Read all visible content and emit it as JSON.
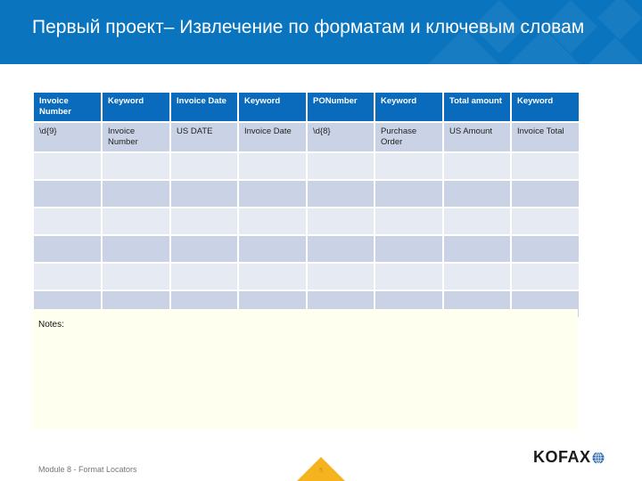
{
  "header": {
    "title": "Первый проект– Извлечение по форматам и ключевым словам",
    "background_color": "#0a74bf"
  },
  "table": {
    "columns": [
      "Invoice Number",
      "Keyword",
      "Invoice Date",
      "Keyword",
      "PONumber",
      "Keyword",
      "Total amount",
      "Keyword"
    ],
    "rows": [
      [
        "\\d{9}",
        "Invoice Number",
        "US DATE",
        "Invoice Date",
        "\\d{8}",
        "Purchase Order",
        "US Amount",
        "Invoice Total"
      ],
      [
        "",
        "",
        "",
        "",
        "",
        "",
        "",
        ""
      ],
      [
        "",
        "",
        "",
        "",
        "",
        "",
        "",
        ""
      ],
      [
        "",
        "",
        "",
        "",
        "",
        "",
        "",
        ""
      ],
      [
        "",
        "",
        "",
        "",
        "",
        "",
        "",
        ""
      ],
      [
        "",
        "",
        "",
        "",
        "",
        "",
        "",
        ""
      ],
      [
        "",
        "",
        "",
        "",
        "",
        "",
        "",
        ""
      ]
    ],
    "header_color": "#0a6bbd",
    "row_color_dark": "#cad3e5",
    "row_color_light": "#e6eaf3"
  },
  "notes": {
    "label": "Notes:",
    "value": ""
  },
  "footer": {
    "module_text": "Module 8 - Format Locators",
    "page_number": "5",
    "page_badge_color": "#f5b41f",
    "logo_text": "KOFAX",
    "logo_icon": "globe-icon"
  }
}
